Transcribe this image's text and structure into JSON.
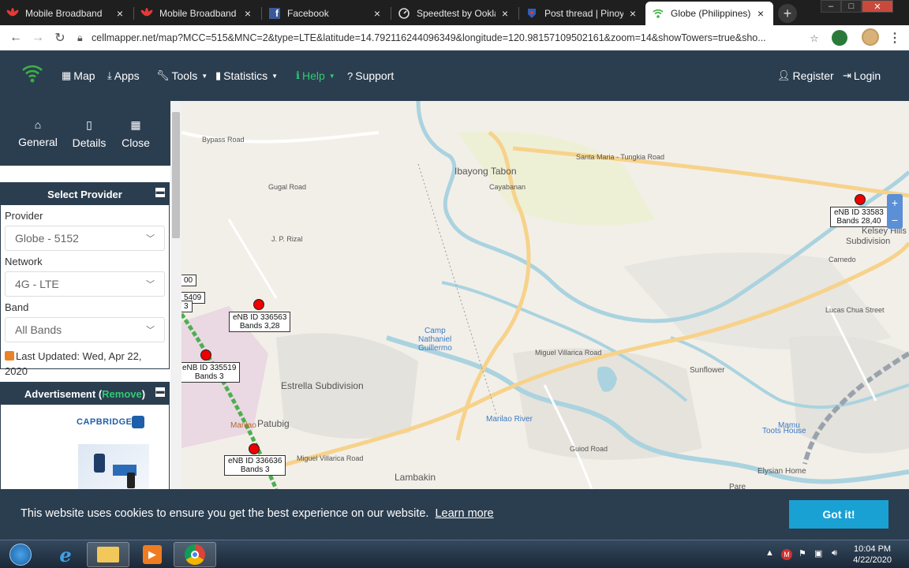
{
  "tabs": [
    {
      "title": "Mobile Broadband",
      "icon": "huawei-icon"
    },
    {
      "title": "Mobile Broadband",
      "icon": "huawei-icon"
    },
    {
      "title": "Facebook",
      "icon": "facebook-icon"
    },
    {
      "title": "Speedtest by Ookla -",
      "icon": "speedtest-icon"
    },
    {
      "title": "Post thread | Pinoy In",
      "icon": "pinoy-icon"
    },
    {
      "title": "Globe (Philippines) -",
      "icon": "cellmapper-icon",
      "active": true
    }
  ],
  "address": {
    "url": "cellmapper.net/map?MCC=515&MNC=2&type=LTE&latitude=14.792116244096349&longitude=120.98157109502161&zoom=14&showTowers=true&sho..."
  },
  "nav": {
    "map": "Map",
    "apps": "Apps",
    "tools": "Tools",
    "statistics": "Statistics",
    "help": "Help",
    "support": "Support",
    "register": "Register",
    "login": "Login"
  },
  "sidetabs": {
    "general": "General",
    "details": "Details",
    "close": "Close"
  },
  "provider_panel": {
    "title": "Select Provider",
    "provider_label": "Provider",
    "provider_value": "Globe - 5152",
    "network_label": "Network",
    "network_value": "4G - LTE",
    "band_label": "Band",
    "band_value": "All Bands",
    "updated": "Last Updated: Wed, Apr 22, 2020"
  },
  "ad_panel": {
    "title": "Advertisement",
    "remove": "Remove",
    "open_paren": "(",
    "close_paren": ")",
    "brand": "CAPBRIDGE"
  },
  "map": {
    "towers": [
      {
        "id": "eNB ID 336563",
        "bands": "Bands 3,28"
      },
      {
        "id": "eNB ID 335519",
        "bands": "Bands 3"
      },
      {
        "id": "eNB ID 336636",
        "bands": "Bands 3"
      },
      {
        "id": "eNB ID 33583",
        "bands": "Bands 28,40"
      }
    ],
    "edge_labels": {
      "a": "00",
      "b": "5409",
      "c": "3"
    },
    "places": {
      "ibayong": "Ibayong Tabon",
      "estrella": "Estrella Subdivision",
      "patubig": "Patubig",
      "lambakin": "Lambakin",
      "camp": "Camp",
      "nathaniel": "Nathaniel",
      "guillermo": "Guillermo",
      "mamu": "Mamu",
      "toots": "Toots House",
      "elysian": "Elysian Home",
      "kelsey": "Kelsey Hills",
      "subdivision": "Subdivision",
      "sunflower": "Sunflower",
      "marilao": "Marilao",
      "pare": "Pare"
    },
    "roads": {
      "bypass": "Bypass Road",
      "santa_maria": "Santa Maria - Tungkia Road",
      "cayabanan": "Cayabanan",
      "rizal": "J. P. Rizal",
      "miguel1": "Miguel Villarica Road",
      "miguel2": "Miguel Villarica Road",
      "river": "Marilao River",
      "guiod": "Guiod Road",
      "gugal": "Gugal Road",
      "lucas": "Lucas Chua Street",
      "carnedo": "Carnedo"
    }
  },
  "cookie": {
    "message": "This website uses cookies to ensure you get the best experience on our website.",
    "learn_more": "Learn more",
    "button": "Got it!"
  },
  "clock": {
    "time": "10:04 PM",
    "date": "4/22/2020"
  },
  "colors": {
    "navbar": "#2b3e50",
    "accent": "#1aa1d3",
    "help": "#2ecc71",
    "tower": "#ee0000"
  }
}
